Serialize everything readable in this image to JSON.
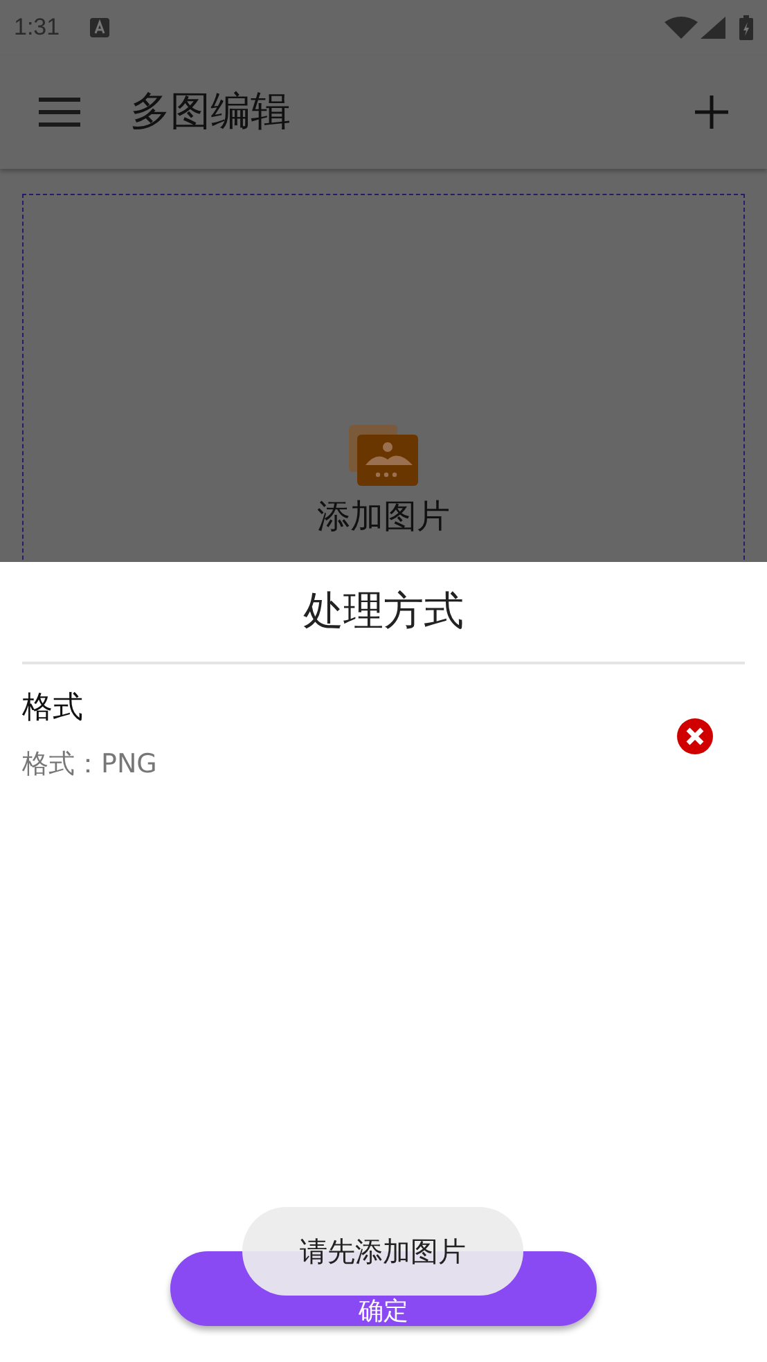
{
  "status_bar": {
    "time": "1:31"
  },
  "app_bar": {
    "title": "多图编辑"
  },
  "upload_area": {
    "label": "添加图片"
  },
  "sheet": {
    "title": "处理方式",
    "items": [
      {
        "title": "格式",
        "detail": "格式：PNG"
      }
    ],
    "confirm_button": "确定"
  },
  "toast": {
    "message": "请先添加图片"
  }
}
